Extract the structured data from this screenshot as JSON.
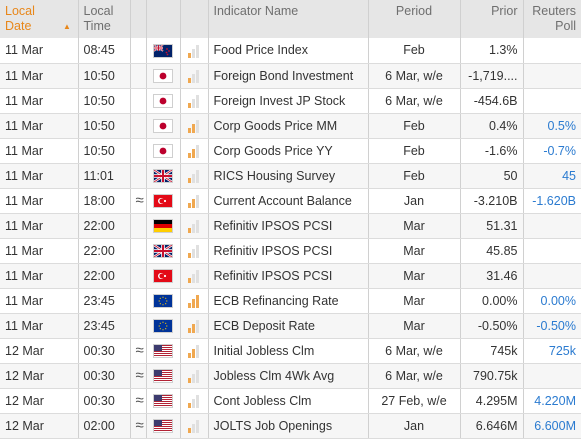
{
  "header": {
    "date": "Local Date",
    "time": "Local Time",
    "indicator": "Indicator Name",
    "period": "Period",
    "prior": "Prior",
    "poll": "Reuters Poll"
  },
  "colors": {
    "accent": "#e8871a",
    "poll": "#2b7bd0",
    "volatility_on": "#f0a850",
    "volatility_off": "#e0e0e0"
  },
  "rows": [
    {
      "date": "11 Mar",
      "time": "08:45",
      "revised": "",
      "flag": "nz",
      "vol": 1,
      "indicator": "Food Price Index",
      "period": "Feb",
      "prior": "1.3%",
      "poll": ""
    },
    {
      "date": "11 Mar",
      "time": "10:50",
      "revised": "",
      "flag": "jp",
      "vol": 1,
      "indicator": "Foreign Bond Investment",
      "period": "6 Mar, w/e",
      "prior": "-1,719....",
      "poll": ""
    },
    {
      "date": "11 Mar",
      "time": "10:50",
      "revised": "",
      "flag": "jp",
      "vol": 1,
      "indicator": "Foreign Invest JP Stock",
      "period": "6 Mar, w/e",
      "prior": "-454.6B",
      "poll": ""
    },
    {
      "date": "11 Mar",
      "time": "10:50",
      "revised": "",
      "flag": "jp",
      "vol": 2,
      "indicator": "Corp Goods Price MM",
      "period": "Feb",
      "prior": "0.4%",
      "poll": "0.5%"
    },
    {
      "date": "11 Mar",
      "time": "10:50",
      "revised": "",
      "flag": "jp",
      "vol": 2,
      "indicator": "Corp Goods Price YY",
      "period": "Feb",
      "prior": "-1.6%",
      "poll": "-0.7%"
    },
    {
      "date": "11 Mar",
      "time": "11:01",
      "revised": "",
      "flag": "gb",
      "vol": 1,
      "indicator": "RICS Housing Survey",
      "period": "Feb",
      "prior": "50",
      "poll": "45"
    },
    {
      "date": "11 Mar",
      "time": "18:00",
      "revised": "≈",
      "flag": "tr",
      "vol": 2,
      "indicator": "Current Account Balance",
      "period": "Jan",
      "prior": "-3.210B",
      "poll": "-1.620B"
    },
    {
      "date": "11 Mar",
      "time": "22:00",
      "revised": "",
      "flag": "de",
      "vol": 1,
      "indicator": "Refinitiv IPSOS PCSI",
      "period": "Mar",
      "prior": "51.31",
      "poll": ""
    },
    {
      "date": "11 Mar",
      "time": "22:00",
      "revised": "",
      "flag": "gb",
      "vol": 1,
      "indicator": "Refinitiv IPSOS PCSI",
      "period": "Mar",
      "prior": "45.85",
      "poll": ""
    },
    {
      "date": "11 Mar",
      "time": "22:00",
      "revised": "",
      "flag": "tr",
      "vol": 1,
      "indicator": "Refinitiv IPSOS PCSI",
      "period": "Mar",
      "prior": "31.46",
      "poll": ""
    },
    {
      "date": "11 Mar",
      "time": "23:45",
      "revised": "",
      "flag": "eu",
      "vol": 3,
      "indicator": "ECB Refinancing Rate",
      "period": "Mar",
      "prior": "0.00%",
      "poll": "0.00%"
    },
    {
      "date": "11 Mar",
      "time": "23:45",
      "revised": "",
      "flag": "eu",
      "vol": 2,
      "indicator": "ECB Deposit Rate",
      "period": "Mar",
      "prior": "-0.50%",
      "poll": "-0.50%"
    },
    {
      "date": "12 Mar",
      "time": "00:30",
      "revised": "≈",
      "flag": "us",
      "vol": 2,
      "indicator": "Initial Jobless Clm",
      "period": "6 Mar, w/e",
      "prior": "745k",
      "poll": "725k"
    },
    {
      "date": "12 Mar",
      "time": "00:30",
      "revised": "≈",
      "flag": "us",
      "vol": 1,
      "indicator": "Jobless Clm 4Wk Avg",
      "period": "6 Mar, w/e",
      "prior": "790.75k",
      "poll": ""
    },
    {
      "date": "12 Mar",
      "time": "00:30",
      "revised": "≈",
      "flag": "us",
      "vol": 1,
      "indicator": "Cont Jobless Clm",
      "period": "27 Feb, w/e",
      "prior": "4.295M",
      "poll": "4.220M"
    },
    {
      "date": "12 Mar",
      "time": "02:00",
      "revised": "≈",
      "flag": "us",
      "vol": 1,
      "indicator": "JOLTS Job Openings",
      "period": "Jan",
      "prior": "6.646M",
      "poll": "6.600M"
    }
  ]
}
